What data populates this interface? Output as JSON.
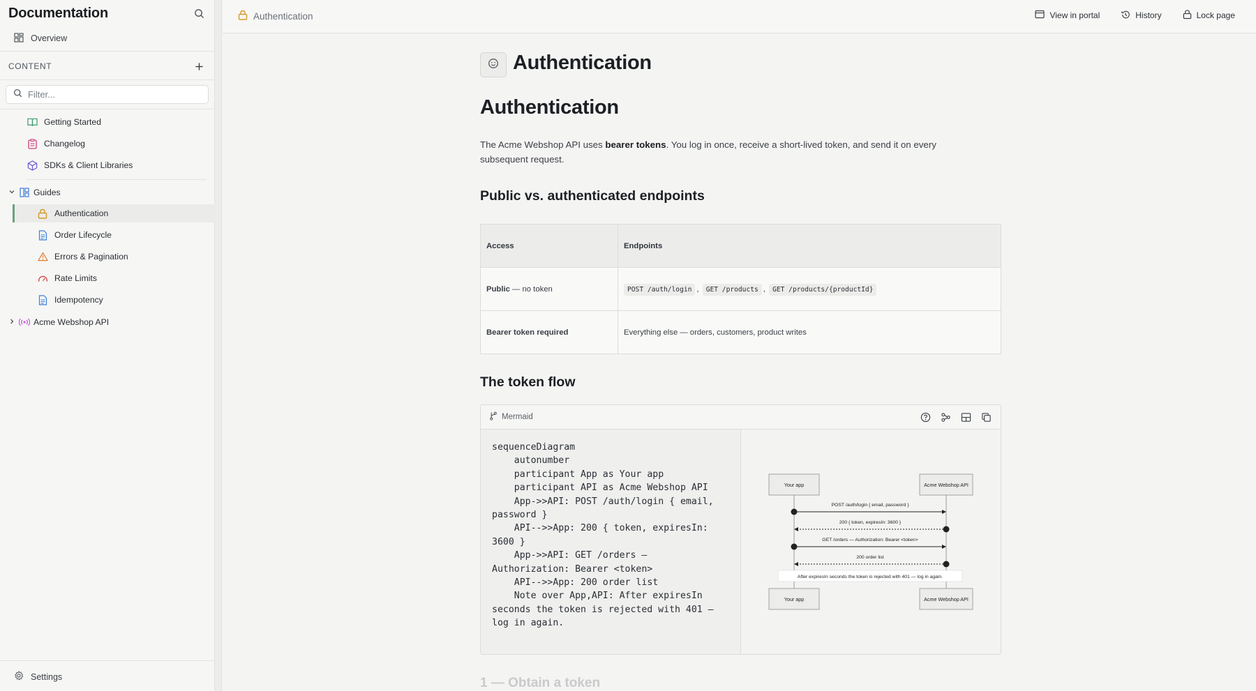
{
  "sidebar": {
    "title": "Documentation",
    "overview": "Overview",
    "section_label": "CONTENT",
    "filter_placeholder": "Filter...",
    "items": [
      {
        "label": "Getting Started",
        "icon": "book-icon"
      },
      {
        "label": "Changelog",
        "icon": "clipboard-icon"
      },
      {
        "label": "SDKs & Client Libraries",
        "icon": "cube-icon"
      }
    ],
    "guides": {
      "label": "Guides",
      "children": [
        {
          "label": "Authentication",
          "icon": "lock-icon",
          "active": true
        },
        {
          "label": "Order Lifecycle",
          "icon": "document-icon"
        },
        {
          "label": "Errors & Pagination",
          "icon": "warning-icon"
        },
        {
          "label": "Rate Limits",
          "icon": "gauge-icon"
        },
        {
          "label": "Idempotency",
          "icon": "document-icon"
        }
      ]
    },
    "api": {
      "label": "Acme Webshop API",
      "icon": "broadcast-icon"
    },
    "settings": "Settings"
  },
  "topbar": {
    "breadcrumb": "Authentication",
    "view_in_portal": "View in portal",
    "history": "History",
    "lock_page": "Lock page"
  },
  "page": {
    "title": "Authentication",
    "h1": "Authentication",
    "intro_before": "The Acme Webshop API uses ",
    "intro_bold": "bearer tokens",
    "intro_after": ". You log in once, receive a short-lived token, and send it on every subsequent request.",
    "h2_endpoints": "Public vs. authenticated endpoints",
    "table": {
      "headers": [
        "Access",
        "Endpoints"
      ],
      "row1_access_bold": "Public",
      "row1_access_rest": " — no token",
      "row1_codes": [
        "POST /auth/login",
        "GET /products",
        "GET /products/{productId}"
      ],
      "row2_access": "Bearer token required",
      "row2_endpoints": "Everything else — orders, customers, product writes"
    },
    "h2_flow": "The token flow",
    "next_heading": "1 — Obtain a token"
  },
  "mermaid": {
    "label": "Mermaid",
    "code": "sequenceDiagram\n    autonumber\n    participant App as Your app\n    participant API as Acme Webshop API\n    App->>API: POST /auth/login { email, password }\n    API-->>App: 200 { token, expiresIn: 3600 }\n    App->>API: GET /orders — Authorization: Bearer <token>\n    API-->>App: 200 order list\n    Note over App,API: After expiresIn seconds the token is rejected with 401 — log in again.",
    "participants": [
      "Your app",
      "Acme Webshop API"
    ],
    "messages": [
      {
        "from": 0,
        "to": 1,
        "text": "POST /auth/login { email, password }",
        "dashed": false
      },
      {
        "from": 1,
        "to": 0,
        "text": "200 { token, expiresIn: 3600 }",
        "dashed": true
      },
      {
        "from": 0,
        "to": 1,
        "text": "GET /orders — Authorization: Bearer <token>",
        "dashed": false
      },
      {
        "from": 1,
        "to": 0,
        "text": "200 order list",
        "dashed": true
      }
    ],
    "note": "After expiresIn seconds the token is rejected with 401 — log in again."
  }
}
